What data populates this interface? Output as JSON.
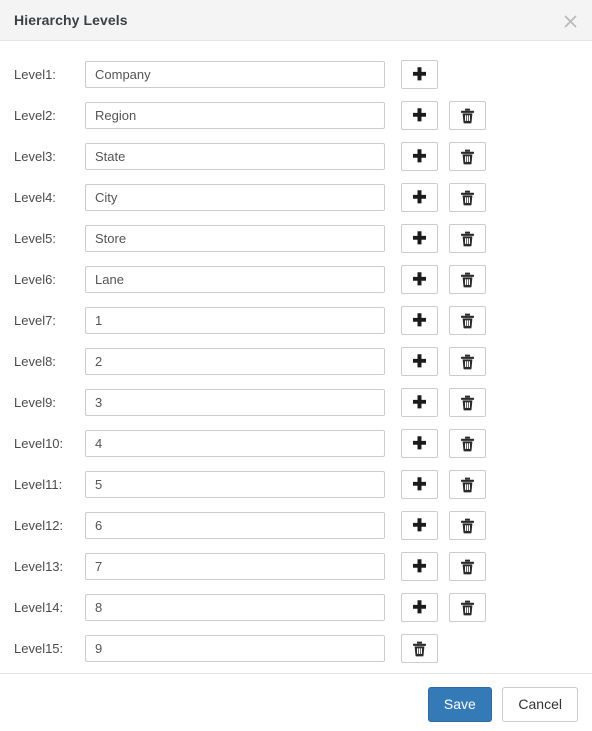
{
  "dialog": {
    "title": "Hierarchy Levels",
    "close_icon": "close-icon",
    "close_label": "×"
  },
  "rows": [
    {
      "label": "Level1:",
      "value": "Company",
      "placeholder": "",
      "has_add": true,
      "has_delete": false
    },
    {
      "label": "Level2:",
      "value": "Region",
      "placeholder": "",
      "has_add": true,
      "has_delete": true
    },
    {
      "label": "Level3:",
      "value": "State",
      "placeholder": "",
      "has_add": true,
      "has_delete": true
    },
    {
      "label": "Level4:",
      "value": "City",
      "placeholder": "",
      "has_add": true,
      "has_delete": true
    },
    {
      "label": "Level5:",
      "value": "Store",
      "placeholder": "",
      "has_add": true,
      "has_delete": true
    },
    {
      "label": "Level6:",
      "value": "Lane",
      "placeholder": "",
      "has_add": true,
      "has_delete": true
    },
    {
      "label": "Level7:",
      "value": "1",
      "placeholder": "",
      "has_add": true,
      "has_delete": true
    },
    {
      "label": "Level8:",
      "value": "2",
      "placeholder": "",
      "has_add": true,
      "has_delete": true
    },
    {
      "label": "Level9:",
      "value": "3",
      "placeholder": "",
      "has_add": true,
      "has_delete": true
    },
    {
      "label": "Level10:",
      "value": "4",
      "placeholder": "",
      "has_add": true,
      "has_delete": true
    },
    {
      "label": "Level11:",
      "value": "5",
      "placeholder": "",
      "has_add": true,
      "has_delete": true
    },
    {
      "label": "Level12:",
      "value": "6",
      "placeholder": "",
      "has_add": true,
      "has_delete": true
    },
    {
      "label": "Level13:",
      "value": "7",
      "placeholder": "",
      "has_add": true,
      "has_delete": true
    },
    {
      "label": "Level14:",
      "value": "8",
      "placeholder": "",
      "has_add": true,
      "has_delete": true
    },
    {
      "label": "Level15:",
      "value": "9",
      "placeholder": "",
      "has_add": false,
      "has_delete": true
    }
  ],
  "icons": {
    "add": "plus-icon",
    "delete": "trash-icon"
  },
  "footer": {
    "save_label": "Save",
    "cancel_label": "Cancel"
  },
  "colors": {
    "header_bg": "#f4f4f4",
    "primary": "#337ab7",
    "primary_border": "#2e6da4",
    "border": "#cccccc",
    "text": "#333333",
    "input_text": "#555555",
    "title_text": "#3c4044"
  }
}
